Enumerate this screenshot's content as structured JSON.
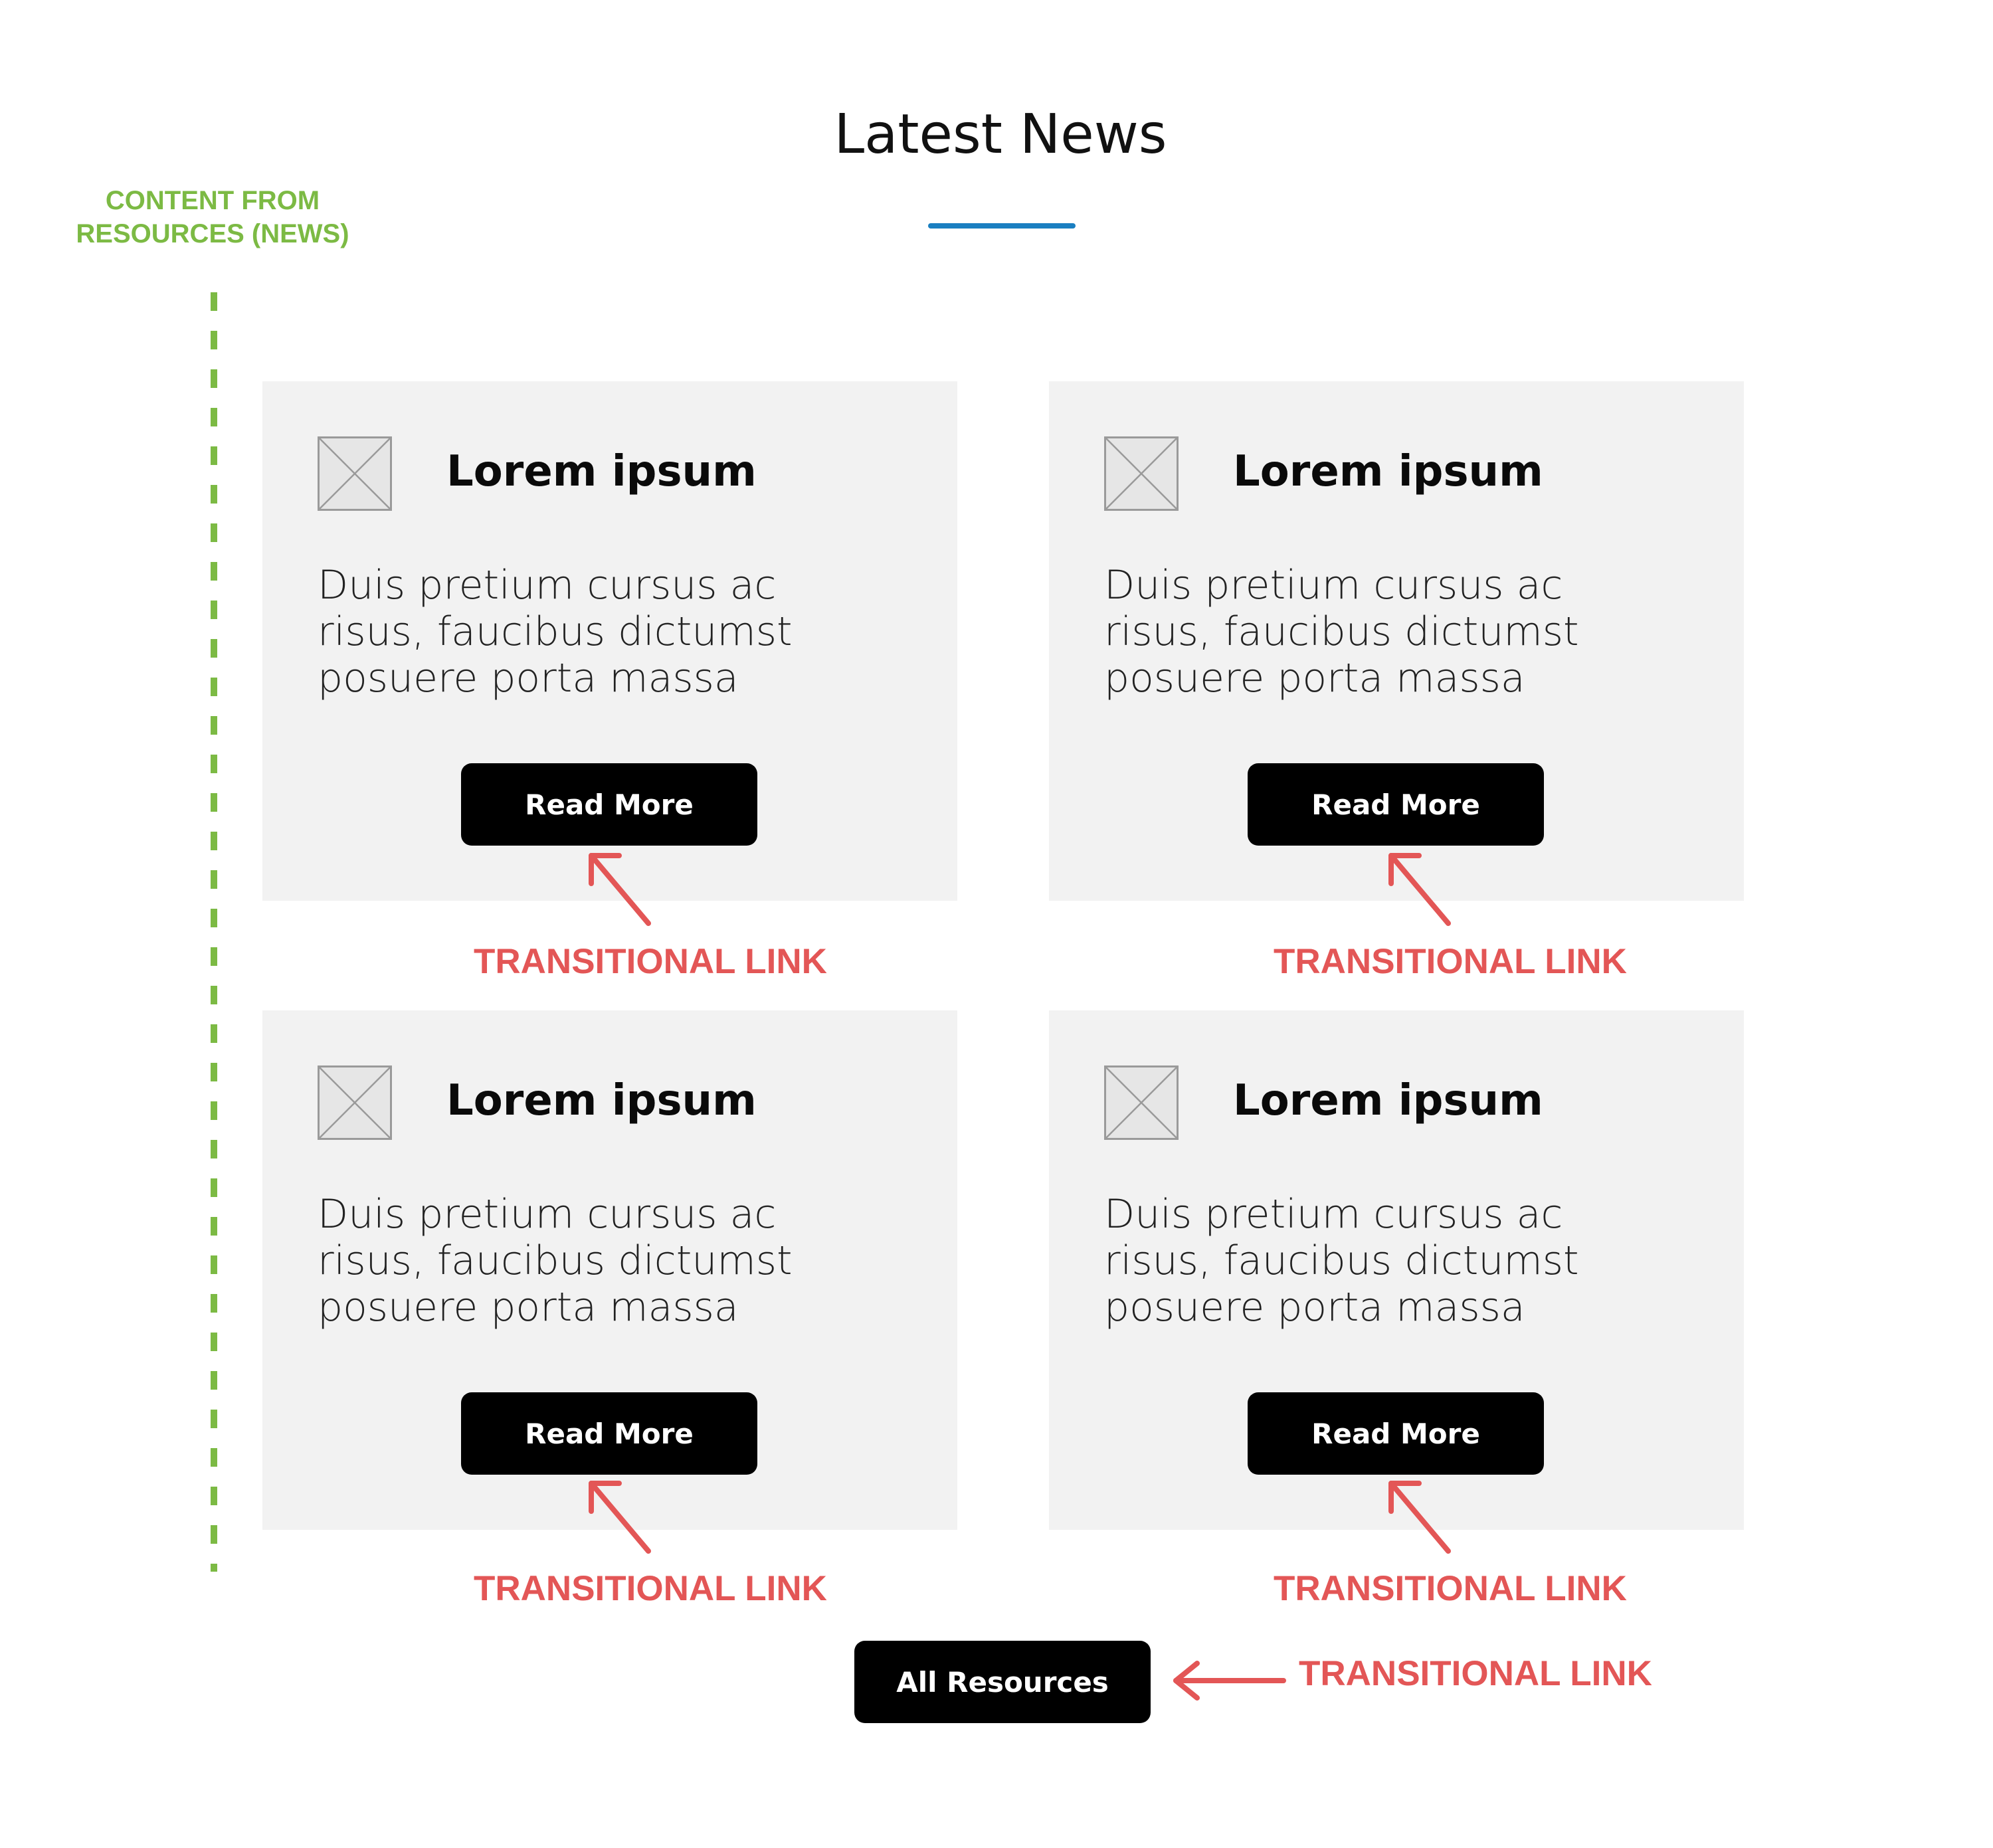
{
  "colors": {
    "accent_blue": "#1a7fc1",
    "annotation_green": "#7cba44",
    "annotation_red": "#e35656",
    "card_background": "#f2f2f2",
    "button_background": "#000000"
  },
  "section": {
    "title": "Latest News"
  },
  "content_note": {
    "line1": "CONTENT FROM",
    "line2": "RESOURCES (NEWS)"
  },
  "cards": [
    {
      "image_icon": "image-placeholder-icon",
      "title": "Lorem ipsum",
      "body_lines": [
        "Duis pretium cursus ac",
        "risus, faucibus dictumst",
        "posuere porta massa"
      ],
      "button_label": "Read More"
    },
    {
      "image_icon": "image-placeholder-icon",
      "title": "Lorem ipsum",
      "body_lines": [
        "Duis pretium cursus ac",
        "risus, faucibus dictumst",
        "posuere porta massa"
      ],
      "button_label": "Read More"
    },
    {
      "image_icon": "image-placeholder-icon",
      "title": "Lorem ipsum",
      "body_lines": [
        "Duis pretium cursus ac",
        "risus, faucibus dictumst",
        "posuere porta massa"
      ],
      "button_label": "Read More"
    },
    {
      "image_icon": "image-placeholder-icon",
      "title": "Lorem ipsum",
      "body_lines": [
        "Duis pretium cursus ac",
        "risus, faucibus dictumst",
        "posuere porta massa"
      ],
      "button_label": "Read More"
    }
  ],
  "annotations": {
    "card_links": [
      "TRANSITIONAL LINK",
      "TRANSITIONAL LINK",
      "TRANSITIONAL LINK",
      "TRANSITIONAL LINK"
    ],
    "all_resources_link": "TRANSITIONAL LINK"
  },
  "footer": {
    "all_resources_label": "All Resources"
  }
}
